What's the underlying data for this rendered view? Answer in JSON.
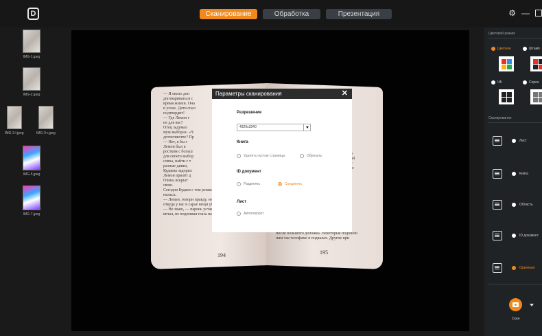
{
  "header": {
    "logo_letter": "D",
    "tabs": [
      {
        "label": "Сканирование",
        "active": true
      },
      {
        "label": "Обработка",
        "active": false
      },
      {
        "label": "Презентация",
        "active": false
      }
    ],
    "icons": [
      "gear-icon",
      "minimize-icon",
      "maximize-icon"
    ]
  },
  "thumbnails": [
    {
      "label": "IMG-1.jpeg"
    },
    {
      "label": "IMG-2.jpeg"
    },
    {
      "label": "IMG-3-l.jpeg"
    },
    {
      "label": "IMG-3-r.jpeg"
    },
    {
      "label": "IMG-5.jpeg"
    },
    {
      "label": "IMG-7.jpeg"
    }
  ],
  "book": {
    "left_lines": [
      "— Я около деп",
      "договариваться с",
      "время жизни. Она",
      "в углах. Дети спал",
      "подтвердит!",
      "— Где Лемон г",
      "не для вас?",
      "Отец задумал",
      "муж выборах. «Ч",
      "детективстве? Пр",
      "— Нет, я бы г",
      "Лемон был в",
      "ростком с больш",
      "для своего выбор",
      "совка, найти с т",
      "разные дивиз,",
      "Кудаева задорил",
      "Лемон прилёт д",
      "Очень вскрыт",
      "свою.",
      "Сегодня Кудаев с тем решил за де",
      "нильса.",
      "— Леман, говори правду, не рядом време",
      "откуда у вас в сарае вещи убитой женщины?",
      "— Не знаю, — парень уставился в пол и от",
      "вечал, не поднимая глаза на полицейских."
    ],
    "right_lines": [
      "вводился отвод?",
      "Лемон обычно начал рассказывать. Она",
      "с днями часто подсуживали за туристами",
      "после большого доложка. Некоторые подошли",
      "ним так телофаме в подвалах. Другие при"
    ],
    "right_margin": [
      "бо",
      "Во",
      "Вой",
      "Ле",
      "Где"
    ],
    "page_left": "194",
    "page_right": "195"
  },
  "dialog": {
    "title": "Параметры сканирования",
    "resolution_title": "Разрешение",
    "resolution_value": "4320x3240",
    "book_title": "Книга",
    "book_opt_1": "Удалять пустые страницы",
    "book_opt_2": "Обрезать",
    "id_title": "ID документ",
    "id_opt_1": "Разделять",
    "id_opt_2": "Соединять",
    "sheet_title": "Лист",
    "sheet_opt_1": "Автоповорот"
  },
  "right_panel": {
    "color_mode_title": "Цветовой режим",
    "color_modes": [
      {
        "label": "Цветное",
        "selected": true
      },
      {
        "label": "Штамп",
        "selected": false
      },
      {
        "label": "ЧБ",
        "selected": false
      },
      {
        "label": "Серое",
        "selected": false
      }
    ],
    "scan_title": "Сканирование",
    "scan_modes": [
      {
        "label": "Лист",
        "icon": "sheet-icon",
        "selected": false
      },
      {
        "label": "Книга",
        "icon": "book-icon",
        "selected": false
      },
      {
        "label": "Область",
        "icon": "area-icon",
        "selected": false
      },
      {
        "label": "ID документ",
        "icon": "id-card-icon",
        "selected": false
      },
      {
        "label": "Оригинал",
        "icon": "original-icon",
        "selected": true
      }
    ],
    "scan_button_label": "Скан"
  },
  "colors": {
    "accent": "#f08a1c",
    "topbar": "#171717",
    "panel": "#202326",
    "tab_inactive": "#3a3f45"
  }
}
